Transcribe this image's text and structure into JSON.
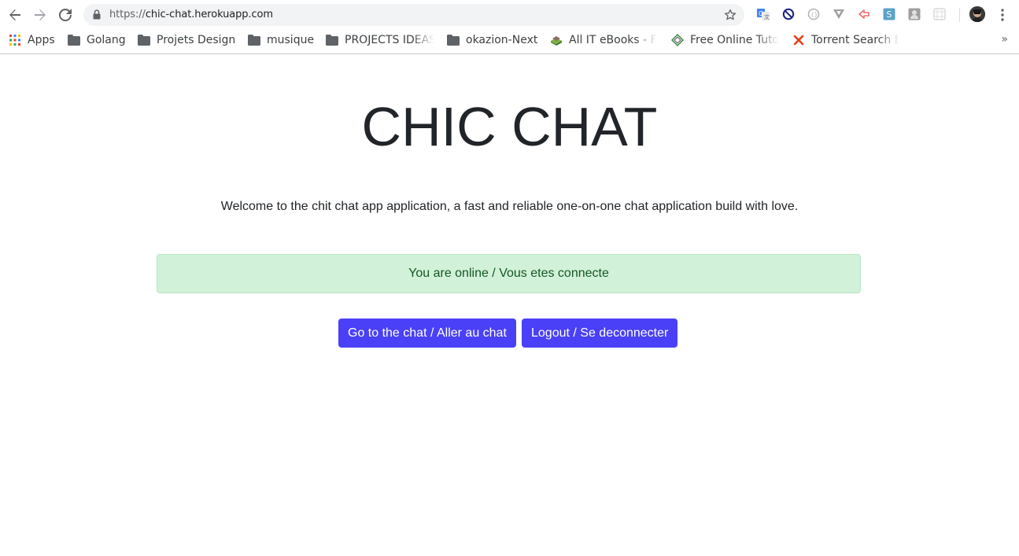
{
  "browser": {
    "url_scheme": "https://",
    "url_host": "chic-chat.herokuapp.com",
    "bookmarks": [
      {
        "label": "Apps",
        "icon": "apps-grid-icon"
      },
      {
        "label": "Golang",
        "icon": "folder-icon"
      },
      {
        "label": "Projets Design",
        "icon": "folder-icon"
      },
      {
        "label": "musique",
        "icon": "folder-icon"
      },
      {
        "label": "PROJECTS IDEAS",
        "icon": "folder-icon"
      },
      {
        "label": "okazion-Next",
        "icon": "folder-icon"
      },
      {
        "label": "All IT eBooks - Fr",
        "icon": "ebook-icon"
      },
      {
        "label": "Free Online Tuto",
        "icon": "tutorial-icon"
      },
      {
        "label": "Torrent Search E",
        "icon": "torrent-x-icon"
      }
    ],
    "more_label": "»",
    "extensions": [
      "translate-icon",
      "block-icon",
      "circle-ext-icon",
      "v-ext-icon",
      "arrow-ext-icon",
      "s-ext-icon",
      "user-ext-icon",
      "grid-ext-icon"
    ]
  },
  "page": {
    "title": "CHIC CHAT",
    "welcome": "Welcome to the chit chat app application, a fast and reliable one-on-one chat application build with love.",
    "status": "You are online / Vous etes connecte",
    "go_chat_label": "Go to the chat / Aller au chat",
    "logout_label": "Logout / Se deconnecter"
  },
  "colors": {
    "primary_button": "#4a40f7",
    "alert_bg": "#d1f1d8",
    "alert_text": "#155724"
  }
}
